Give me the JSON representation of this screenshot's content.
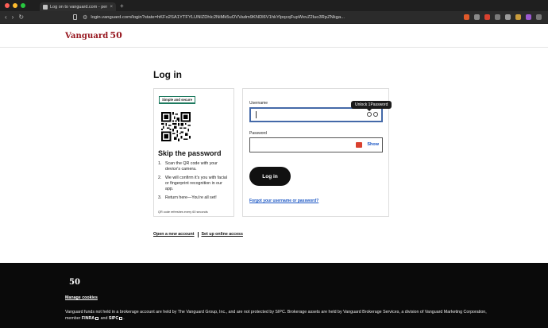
{
  "browser": {
    "tab_title": "Log on to vanguard.com - per",
    "url": "login.vanguard.com/login?state=hKFo2SA1YTFYLUNlZDhlc2NiMk5uOVVadm9KNDl6V1hkYlpqcqFupWxvZ2luo3RpZNkga...",
    "colors": {
      "close": "#ff5f57",
      "minimize": "#febc2e",
      "maximize": "#28c840"
    }
  },
  "header": {
    "brand": "Vanguard",
    "brand_suffix": "50",
    "brand_color": "#96151d"
  },
  "page": {
    "title": "Log in"
  },
  "qr_panel": {
    "badge": "Simple and secure",
    "heading": "Skip the password",
    "steps": [
      {
        "num": "1.",
        "text": "Scan the QR code with your device's camera."
      },
      {
        "num": "2.",
        "text": "We will confirm it's you with facial or fingerprint recognition in our app."
      },
      {
        "num": "3.",
        "text": "Return here—You're all set!"
      }
    ],
    "note": "QR code refreshes every 60 seconds"
  },
  "login_form": {
    "username_label": "Username",
    "username_value": "",
    "password_label": "Password",
    "password_value": "",
    "tooltip": "Unlock 1Password",
    "show_label": "Show",
    "submit_label": "Log in",
    "forgot_label": "Forgot your username or password?"
  },
  "bottom_links": {
    "open_account": "Open a new account",
    "setup_access": "Set up online access"
  },
  "footer": {
    "logo": "50",
    "manage_cookies": "Manage cookies",
    "disclaimer_part1": "Vanguard funds not held in a brokerage account are held by The Vanguard Group, Inc., and are not protected by SIPC. Brokerage assets are held by Vanguard Brokerage Services, a division of Vanguard Marketing Corporation, member",
    "finra": "FINRA",
    "and": "and",
    "sipc": "SIPC",
    "period": "."
  }
}
